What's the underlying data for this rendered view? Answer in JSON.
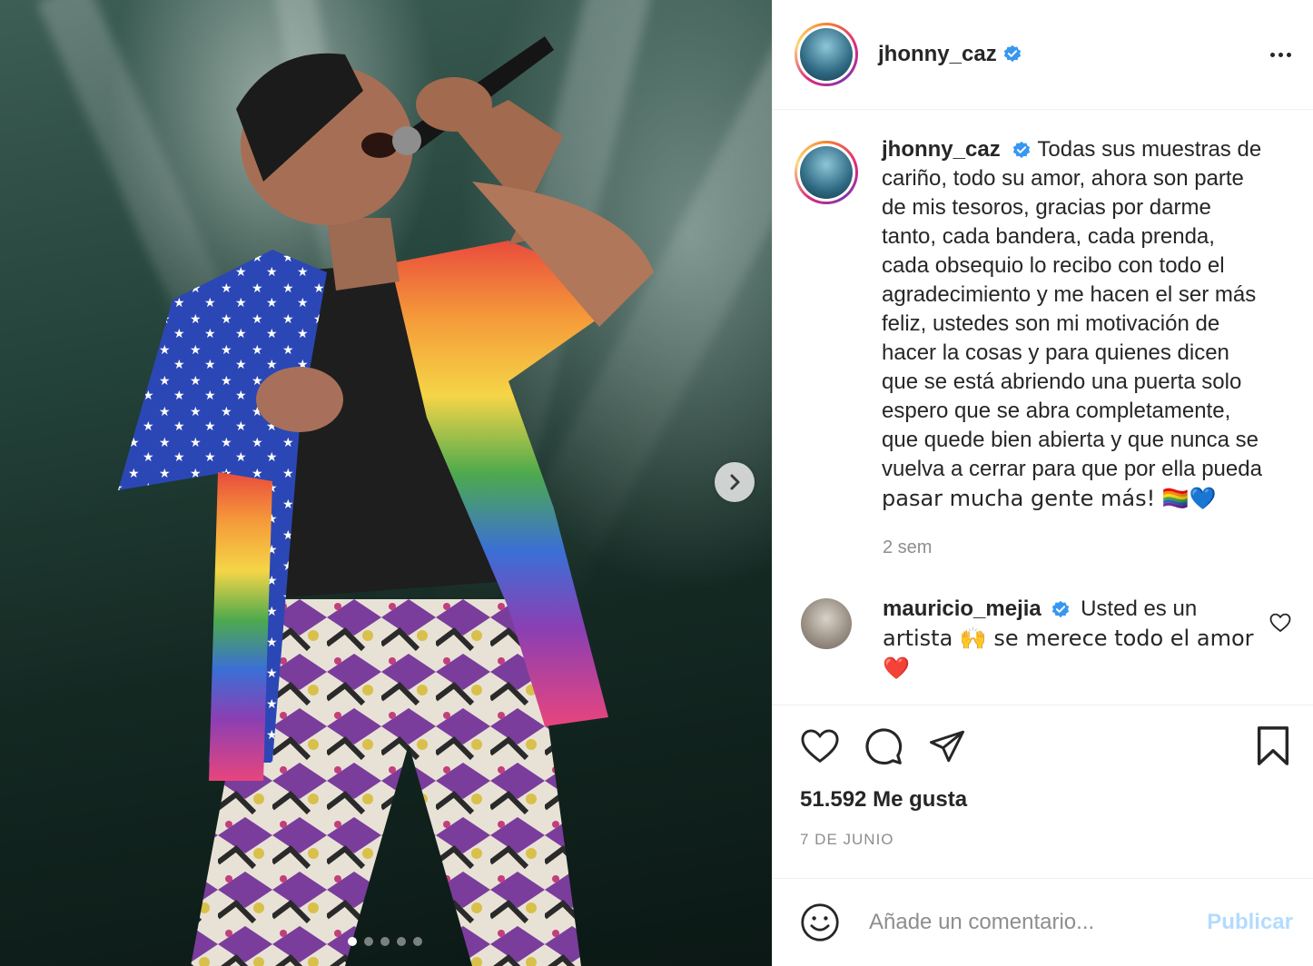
{
  "post": {
    "username": "jhonny_caz",
    "caption_lines": [
      "Todas sus muestras de",
      "cariño, todo su amor, ahora son parte",
      "de mis tesoros, gracias por darme",
      "tanto, cada bandera, cada prenda,",
      "cada obsequio lo recibo con todo el",
      "agradecimiento y me hacen el ser más",
      "feliz, ustedes son mi motivación de",
      "hacer la cosas y para quienes dicen",
      "que se está abriendo una puerta solo",
      "espero que se abra completamente,",
      "que quede bien abierta y que nunca se",
      "vuelva a cerrar para que por ella pueda",
      "pasar mucha gente más! 🏳️‍🌈💙"
    ],
    "time_ago": "2 sem",
    "likes": "51.592 Me gusta",
    "date": "7 DE JUNIO"
  },
  "comment": {
    "username": "mauricio_mejia",
    "text_line1": "Usted es un",
    "text_line2": "artista 🙌 se merece todo el amor",
    "text_line3": "❤️"
  },
  "add_comment": {
    "placeholder": "Añade un comentario...",
    "publish_label": "Publicar"
  },
  "carousel": {
    "slide_count": 5,
    "active_index": 0
  }
}
